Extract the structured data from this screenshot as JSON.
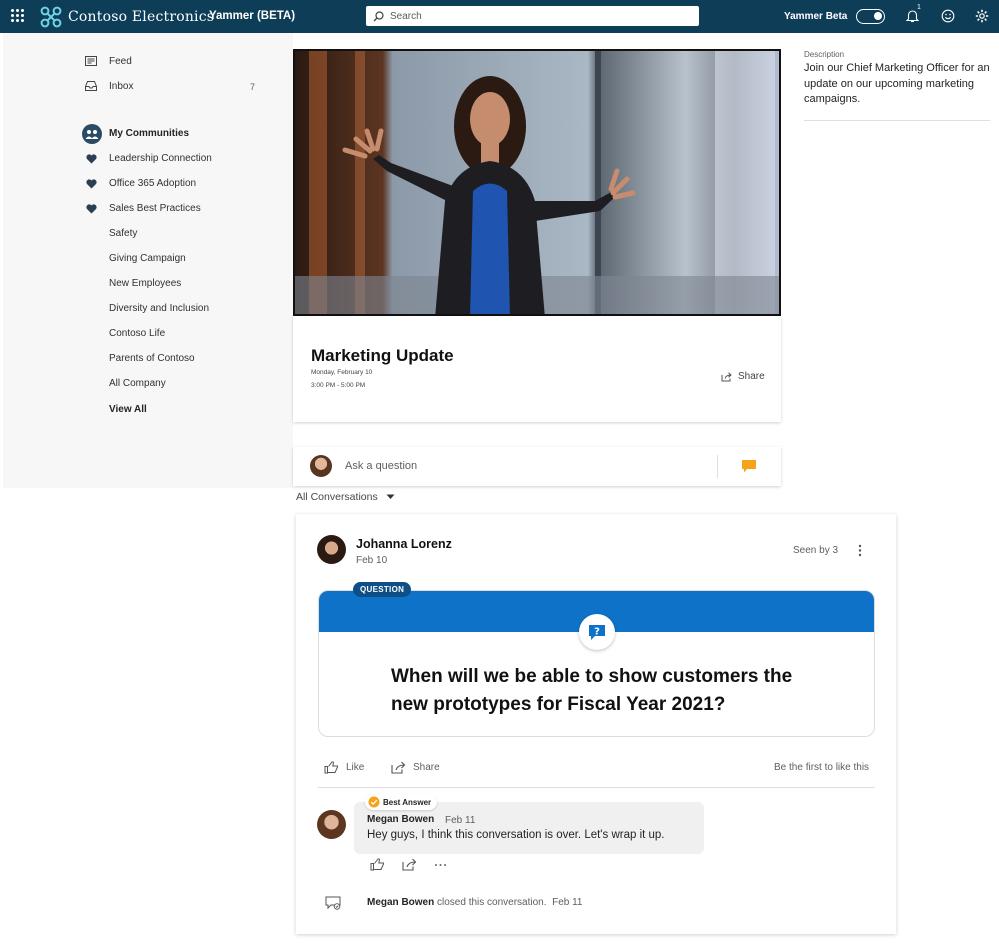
{
  "header": {
    "brand": "Contoso Electronics",
    "app_name": "Yammer (BETA)",
    "search_placeholder": "Search",
    "beta_label": "Yammer Beta",
    "notification_count": "1"
  },
  "sidebar": {
    "items": [
      {
        "label": "Feed",
        "icon": "feed-icon"
      },
      {
        "label": "Inbox",
        "icon": "inbox-icon",
        "count": "7"
      }
    ],
    "communities_header": "My Communities",
    "communities": [
      {
        "label": "Leadership Connection",
        "favorite": true
      },
      {
        "label": "Office 365 Adoption",
        "favorite": true
      },
      {
        "label": "Sales Best Practices",
        "favorite": true
      },
      {
        "label": "Safety",
        "favorite": false
      },
      {
        "label": "Giving Campaign",
        "favorite": false
      },
      {
        "label": "New Employees",
        "favorite": false
      },
      {
        "label": "Diversity and Inclusion",
        "favorite": false
      },
      {
        "label": "Contoso Life",
        "favorite": false
      },
      {
        "label": "Parents of Contoso",
        "favorite": false
      },
      {
        "label": "All Company",
        "favorite": false
      }
    ],
    "view_all": "View All"
  },
  "event": {
    "title": "Marketing Update",
    "date": "Monday, February 10",
    "time": "3:00 PM - 5:00 PM",
    "share_label": "Share"
  },
  "description": {
    "label": "Description",
    "text": "Join our Chief Marketing Officer for an update on our upcoming marketing campaigns."
  },
  "ask": {
    "placeholder": "Ask a question"
  },
  "filter": {
    "label": "All Conversations"
  },
  "post": {
    "author": "Johanna Lorenz",
    "date": "Feb 10",
    "seen_by": "Seen by 3",
    "badge": "QUESTION",
    "question": "When will we be able to show customers the new prototypes for Fiscal Year 2021?",
    "like_label": "Like",
    "share_label": "Share",
    "first_like": "Be the first to like this"
  },
  "reply": {
    "badge": "Best Answer",
    "author": "Megan Bowen",
    "date": "Feb 11",
    "body": "Hey guys, I think this conversation is over.  Let's wrap it up."
  },
  "closed": {
    "author": "Megan Bowen",
    "text": "closed this conversation.",
    "date": "Feb 11"
  },
  "colors": {
    "header_bg": "#0e3d58",
    "accent_blue": "#0f72c9",
    "badge_blue": "#0f4f86",
    "ask_icon": "#f7a21b",
    "best_answer": "#f7a21b"
  }
}
